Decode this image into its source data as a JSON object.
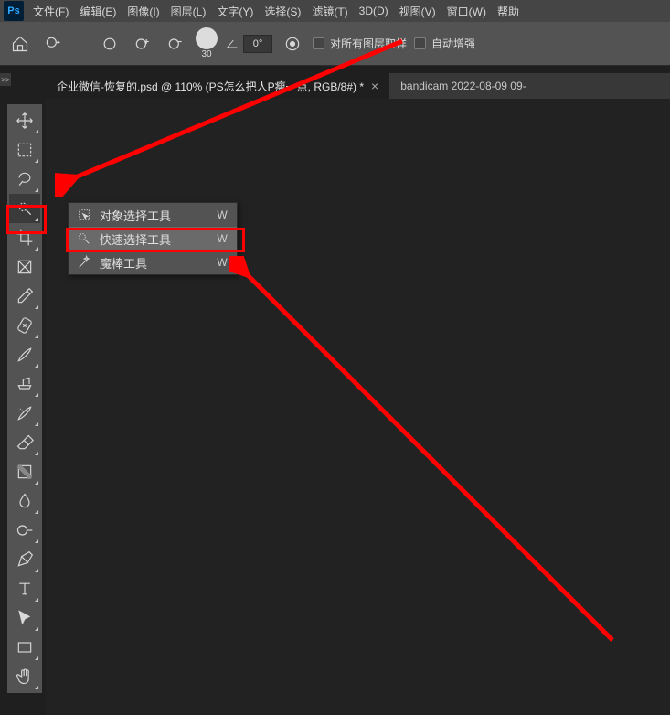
{
  "menu": {
    "items": [
      "文件(F)",
      "编辑(E)",
      "图像(I)",
      "图层(L)",
      "文字(Y)",
      "选择(S)",
      "滤镜(T)",
      "3D(D)",
      "视图(V)",
      "窗口(W)",
      "帮助"
    ]
  },
  "optbar": {
    "brush_size": "30",
    "angle": "0°",
    "sample_all": "对所有图层取样",
    "auto_enhance": "自动增强"
  },
  "doc_tabs": {
    "active_title": "企业微信-恢复的.psd @ 110% (PS怎么把人P瘦一点, RGB/8#) *",
    "close": "×",
    "second_title": "bandicam 2022-08-09 09-"
  },
  "flyout": {
    "items": [
      {
        "label": "对象选择工具",
        "short": "W"
      },
      {
        "label": "快速选择工具",
        "short": "W"
      },
      {
        "label": "魔棒工具",
        "short": "W"
      }
    ]
  },
  "expander": ">>",
  "logo": "Ps"
}
